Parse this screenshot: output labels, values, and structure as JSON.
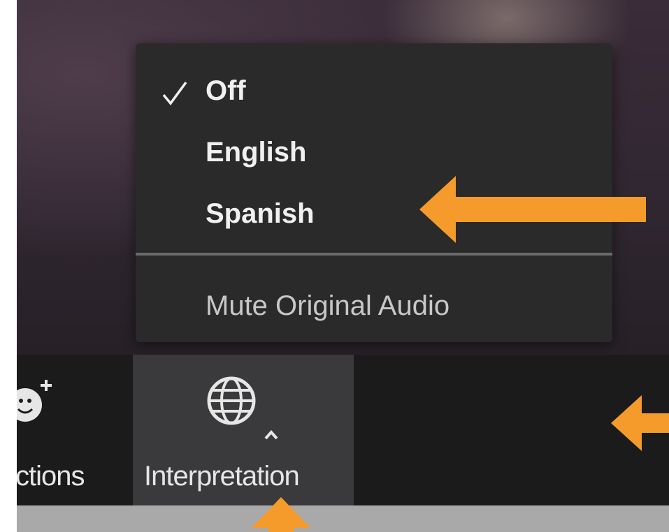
{
  "menu": {
    "items": [
      {
        "label": "Off",
        "checked": true
      },
      {
        "label": "English",
        "checked": false
      },
      {
        "label": "Spanish",
        "checked": false
      }
    ],
    "mute_label": "Mute Original Audio"
  },
  "toolbar": {
    "reactions_label": "ctions",
    "interpretation_label": "Interpretation"
  },
  "colors": {
    "arrow": "#f59b2b",
    "menu_bg": "#2a2a2b",
    "toolbar_bg": "#1b1b1c",
    "active_bg": "#3a3a3c"
  },
  "icons": {
    "check": "check-icon",
    "globe": "globe-icon",
    "caret": "caret-up-icon",
    "reactions": "emoji-add-icon"
  }
}
